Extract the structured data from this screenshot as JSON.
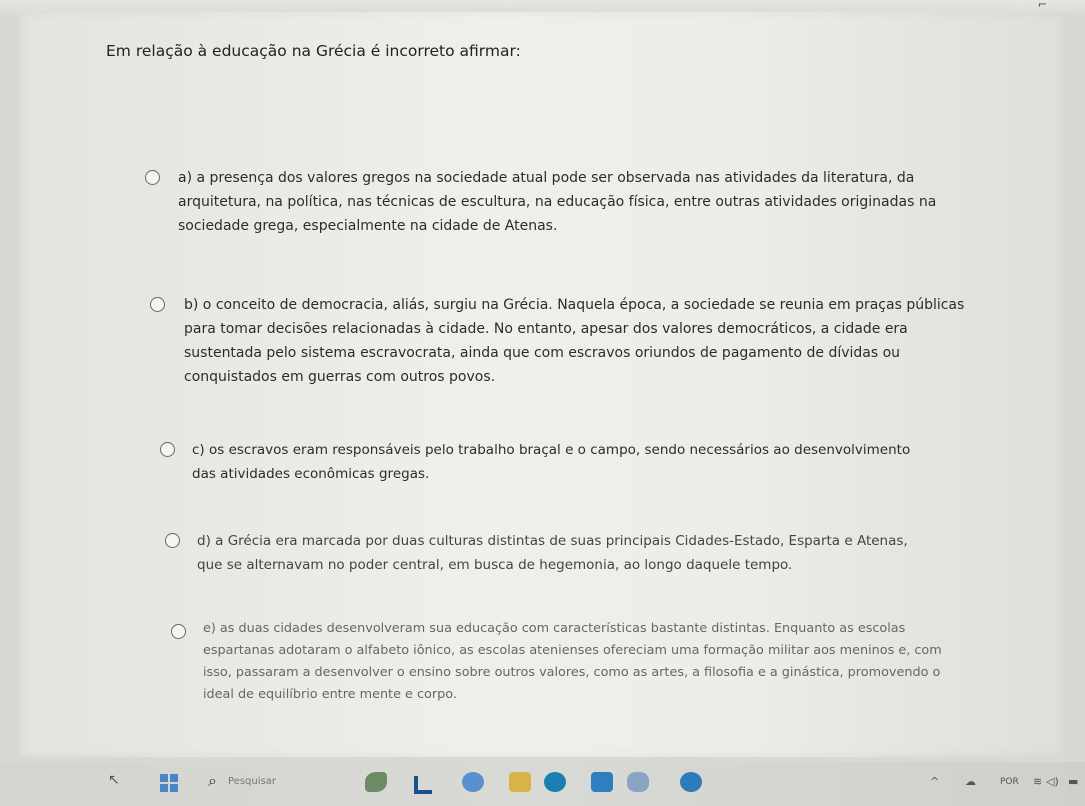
{
  "question": {
    "text": "Em relação à educação na Grécia é incorreto afirmar:"
  },
  "options": [
    {
      "letter": "a",
      "text": "a) a presença dos valores gregos na sociedade atual pode ser observada nas atividades da literatura, da arquitetura, na política, nas técnicas de escultura, na educação física, entre outras atividades originadas na sociedade grega, especialmente na cidade de Atenas."
    },
    {
      "letter": "b",
      "text": "b) o conceito de democracia, aliás, surgiu na Grécia. Naquela época, a sociedade se reunia em praças públicas para tomar decisões relacionadas à cidade. No entanto, apesar dos valores democráticos, a cidade era sustentada pelo sistema escravocrata, ainda que com escravos oriundos de pagamento de dívidas ou conquistados em guerras com outros povos."
    },
    {
      "letter": "c",
      "text": "c) os escravos eram responsáveis pelo trabalho braçal e o campo, sendo necessários ao desenvolvimento das atividades econômicas gregas."
    },
    {
      "letter": "d",
      "text": "d) a Grécia era marcada por duas culturas distintas de suas principais Cidades-Estado, Esparta e Atenas, que se alternavam no poder central, em busca de hegemonia, ao longo daquele tempo."
    },
    {
      "letter": "e",
      "text": "e) as duas cidades desenvolveram sua educação com características bastante distintas. Enquanto as escolas espartanas adotaram o alfabeto iônico, as escolas atenienses ofereciam uma formação militar aos meninos e, com isso, passaram a desenvolver o ensino sobre outros valores, como as artes, a filosofia e a ginástica, promovendo o ideal de equilíbrio entre mente e corpo."
    }
  ],
  "taskbar": {
    "search_placeholder": "Pesquisar",
    "language": "POR",
    "apps": [
      "app-icon",
      "folder-icon",
      "chat-icon",
      "files-icon",
      "edge-icon",
      "store-icon",
      "game-icon",
      "browser-icon"
    ]
  }
}
